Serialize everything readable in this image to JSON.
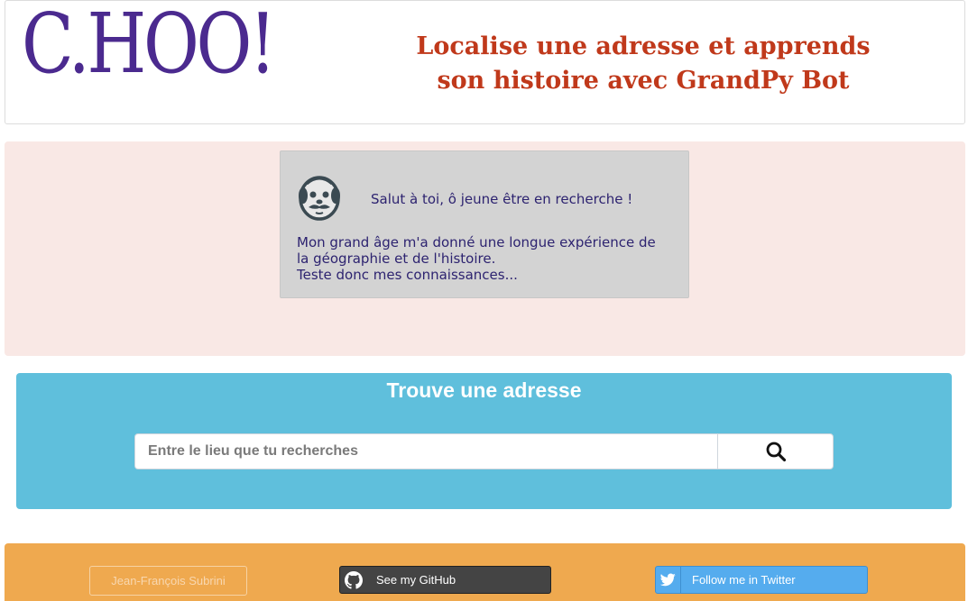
{
  "header": {
    "logo_text": "C.HOO!",
    "tagline_line1": "Localise une adresse et apprends",
    "tagline_line2": "son histoire avec GrandPy Bot"
  },
  "bot": {
    "avatar_icon": "grandpa-bot-icon",
    "greeting": "Salut à toi, ô jeune être en recherche !",
    "message_line1": "Mon grand âge m'a donné une longue expérience de",
    "message_line2": "la géographie et de l'histoire.",
    "message_line3": "Teste donc mes connaissances..."
  },
  "search": {
    "title": "Trouve une adresse",
    "input_value": "",
    "placeholder": "Entre le lieu que tu recherches",
    "button_icon": "search-icon"
  },
  "footer": {
    "author_label": "Jean-François Subrini",
    "github_label": "See my GitHub",
    "github_icon": "github-icon",
    "twitter_label": "Follow me in Twitter",
    "twitter_icon": "twitter-icon"
  },
  "colors": {
    "logo": "#4b2a8f",
    "tagline": "#c0391b",
    "bot_section_bg": "#f9e8e5",
    "bot_card_bg": "#d3d3d3",
    "search_section_bg": "#5fbfdc",
    "footer_bg": "#efa94f",
    "github_button_bg": "#444444",
    "twitter_button_bg": "#55acee"
  }
}
